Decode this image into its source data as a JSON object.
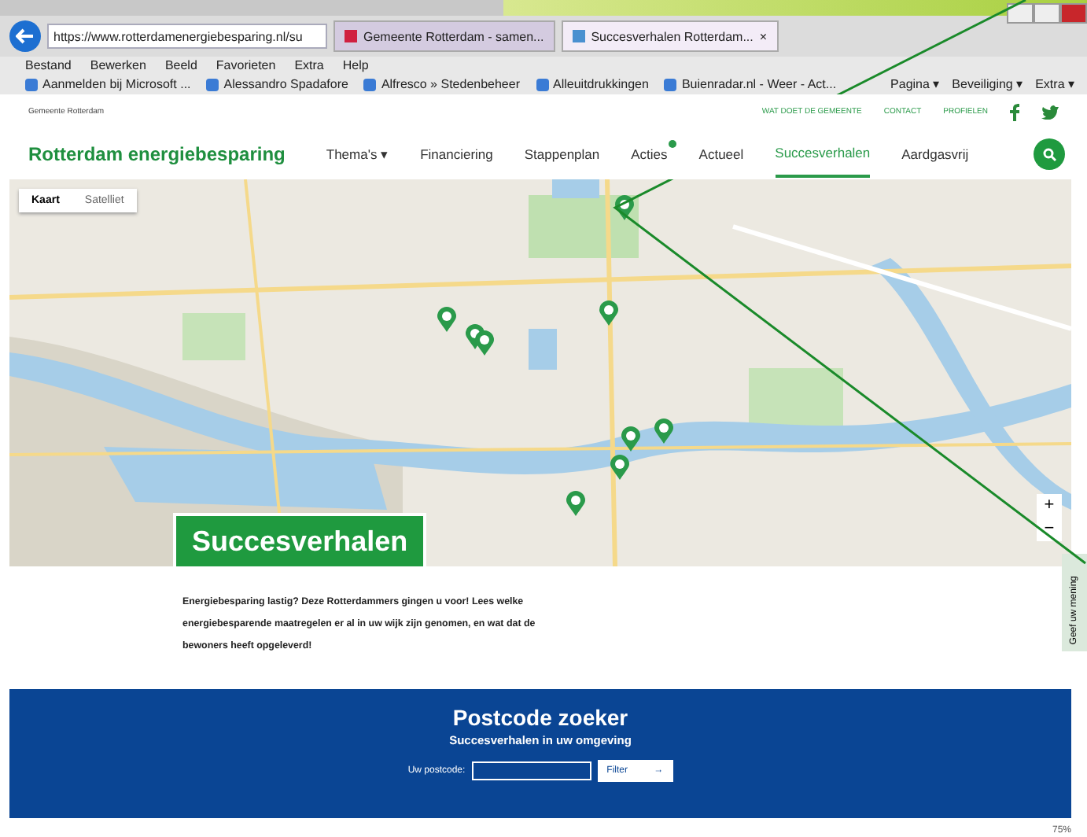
{
  "browser": {
    "address": "https://www.rotterdamenergiebesparing.nl/su",
    "tabs": [
      {
        "label": "Gemeente Rotterdam - samen...",
        "selected": false
      },
      {
        "label": "Succesverhalen Rotterdam...",
        "selected": true
      }
    ],
    "tab_close": "×",
    "menu": [
      "Bestand",
      "Bewerken",
      "Beeld",
      "Favorieten",
      "Extra",
      "Help"
    ],
    "favorites": [
      "Aanmelden bij Microsoft ...",
      "Alessandro Spadafore",
      "Alfresco » Stedenbeheer",
      "Alleuitdrukkingen",
      "Buienradar.nl - Weer - Act..."
    ],
    "tools": [
      "Pagina ▾",
      "Beveiliging ▾",
      "Extra ▾"
    ]
  },
  "site": {
    "logo": "Gemeente Rotterdam",
    "top_links": [
      "WAT DOET DE GEMEENTE",
      "CONTACT",
      "PROFIELEN"
    ],
    "brand": "Rotterdam energiebesparing",
    "nav": [
      {
        "label": "Thema's ▾",
        "selected": false,
        "badge": false
      },
      {
        "label": "Financiering",
        "selected": false,
        "badge": false
      },
      {
        "label": "Stappenplan",
        "selected": false,
        "badge": false
      },
      {
        "label": "Acties",
        "selected": false,
        "badge": true
      },
      {
        "label": "Actueel",
        "selected": false,
        "badge": false
      },
      {
        "label": "Succesverhalen",
        "selected": true,
        "badge": false
      },
      {
        "label": "Aardgasvrij",
        "selected": false,
        "badge": false
      }
    ]
  },
  "map": {
    "types": [
      {
        "label": "Kaart",
        "selected": true
      },
      {
        "label": "Satelliet",
        "selected": false
      }
    ],
    "zoom": [
      "+",
      "−"
    ],
    "banner": "Succesverhalen"
  },
  "intro": "Energiebesparing lastig? Deze Rotterdammers gingen u voor! Lees welke energiebesparende maatregelen er al in uw wijk zijn genomen, en wat dat de bewoners heeft opgeleverd!",
  "postcode": {
    "title": "Postcode zoeker",
    "subtitle": "Succesverhalen in uw omgeving",
    "label": "Uw postcode:",
    "button": "Filter",
    "arrow": "→"
  },
  "feedback": "Geef uw mening",
  "status_bar": {
    "zoom": "75%"
  }
}
